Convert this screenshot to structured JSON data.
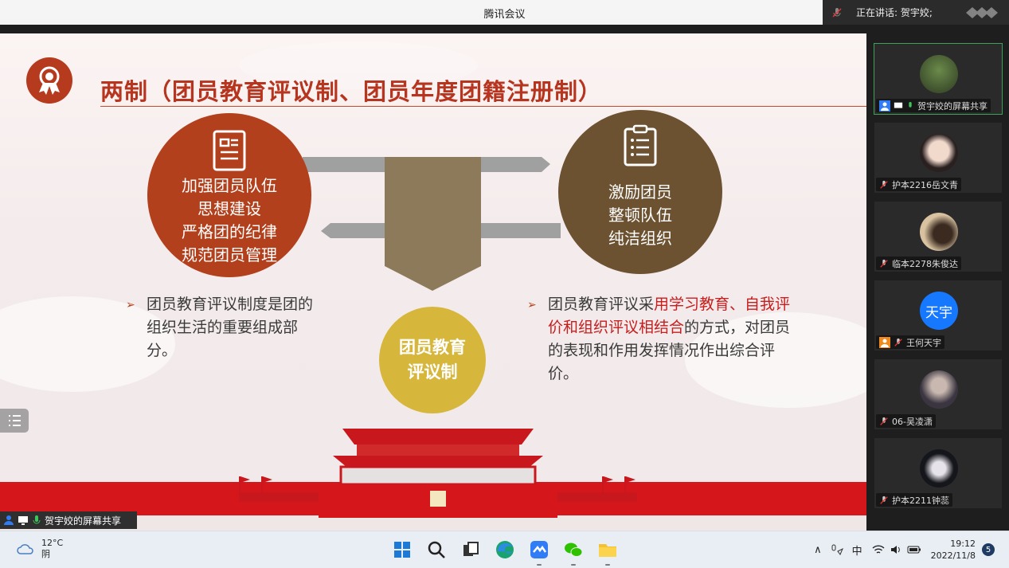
{
  "window": {
    "title": "腾讯会议",
    "speaking_label": "正在讲话: 贺宇姣;"
  },
  "slide": {
    "title": "两制（团员教育评议制、团员年度团籍注册制）",
    "left_circle": [
      "加强团员队伍",
      "思想建设",
      "严格团的纪律",
      "规范团员管理"
    ],
    "right_circle": [
      "激励团员",
      "整顿队伍",
      "纯洁组织"
    ],
    "center_circle": [
      "团员教育",
      "评议制"
    ],
    "bullet_left": "团员教育评议制度是团的组织生活的重要组成部分。",
    "bullet_right_pre": "团员教育评议采",
    "bullet_right_hl": "用学习教育、自我评价和组织评议相结合",
    "bullet_right_post": "的方式，对团员的表现和作用发挥情况作出综合评价。",
    "bullet_marker": "➢"
  },
  "share_strip": {
    "label": "贺宇姣的屏幕共享"
  },
  "participants": [
    {
      "name": "贺宇姣的屏幕共享",
      "avatar": "photo-palm",
      "active": true
    },
    {
      "name": "护本2216岳文青",
      "avatar": "photo-girl"
    },
    {
      "name": "临本2278朱俊达",
      "avatar": "photo-room"
    },
    {
      "name": "王何天宇",
      "avatar_text": "天宇",
      "avatar_color": "#1677ff"
    },
    {
      "name": "06-吴凌潇",
      "avatar": "photo-dark"
    },
    {
      "name": "护本2211钟蕊",
      "avatar": "photo-anime"
    }
  ],
  "taskbar": {
    "temp": "12°C",
    "weather": "阴",
    "ime": "中",
    "time": "19:12",
    "date": "2022/11/8",
    "notifications": "5",
    "apps": [
      "windows-start-icon",
      "search-icon",
      "taskview-icon",
      "edge-icon",
      "tencent-meeting-icon",
      "wechat-icon",
      "file-explorer-icon"
    ]
  },
  "colors": {
    "accent_red": "#b3401d",
    "brown": "#6d5232",
    "gold": "#d7b63c",
    "highlight": "#c81d1d"
  }
}
